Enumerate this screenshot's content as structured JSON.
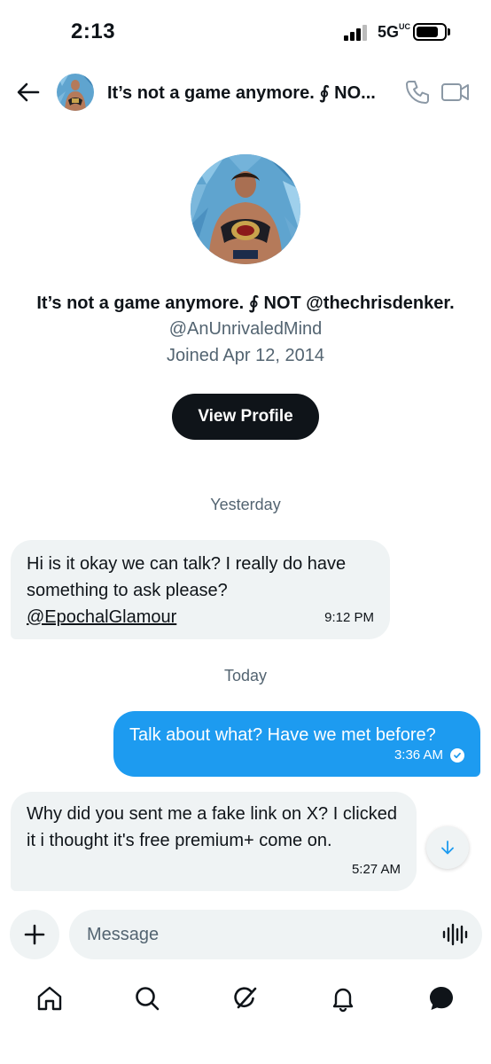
{
  "status_bar": {
    "time": "2:13",
    "network": "5G",
    "network_suffix": "UC"
  },
  "header": {
    "title": "It’s not a game anymore. ∮ NO..."
  },
  "profile": {
    "name": "It’s not a game anymore. ∮ NOT @thechrisdenker.",
    "handle": "@AnUnrivaledMind",
    "joined": "Joined Apr 12, 2014",
    "view_profile_label": "View Profile"
  },
  "conversation": {
    "separators": [
      "Yesterday",
      "Today"
    ],
    "messages": [
      {
        "direction": "incoming",
        "text": "Hi is it okay we can talk? I really do have something to ask please?",
        "mention": "@EpochalGlamour",
        "time": "9:12 PM"
      },
      {
        "direction": "outgoing",
        "text": "Talk about what? Have we met before?",
        "time": "3:36 AM",
        "status": "read"
      },
      {
        "direction": "incoming",
        "text": "Why did you sent me a fake link on X? I clicked it i thought it's free premium+ come on.",
        "time": "5:27 AM"
      }
    ]
  },
  "composer": {
    "placeholder": "Message"
  },
  "nav": {
    "items": [
      "home-icon",
      "search-icon",
      "grok-icon",
      "notifications-icon",
      "messages-icon"
    ]
  },
  "colors": {
    "accent": "#1d9bf0",
    "bubble_incoming": "#eff3f4",
    "text": "#0f1419",
    "secondary_text": "#536471"
  }
}
